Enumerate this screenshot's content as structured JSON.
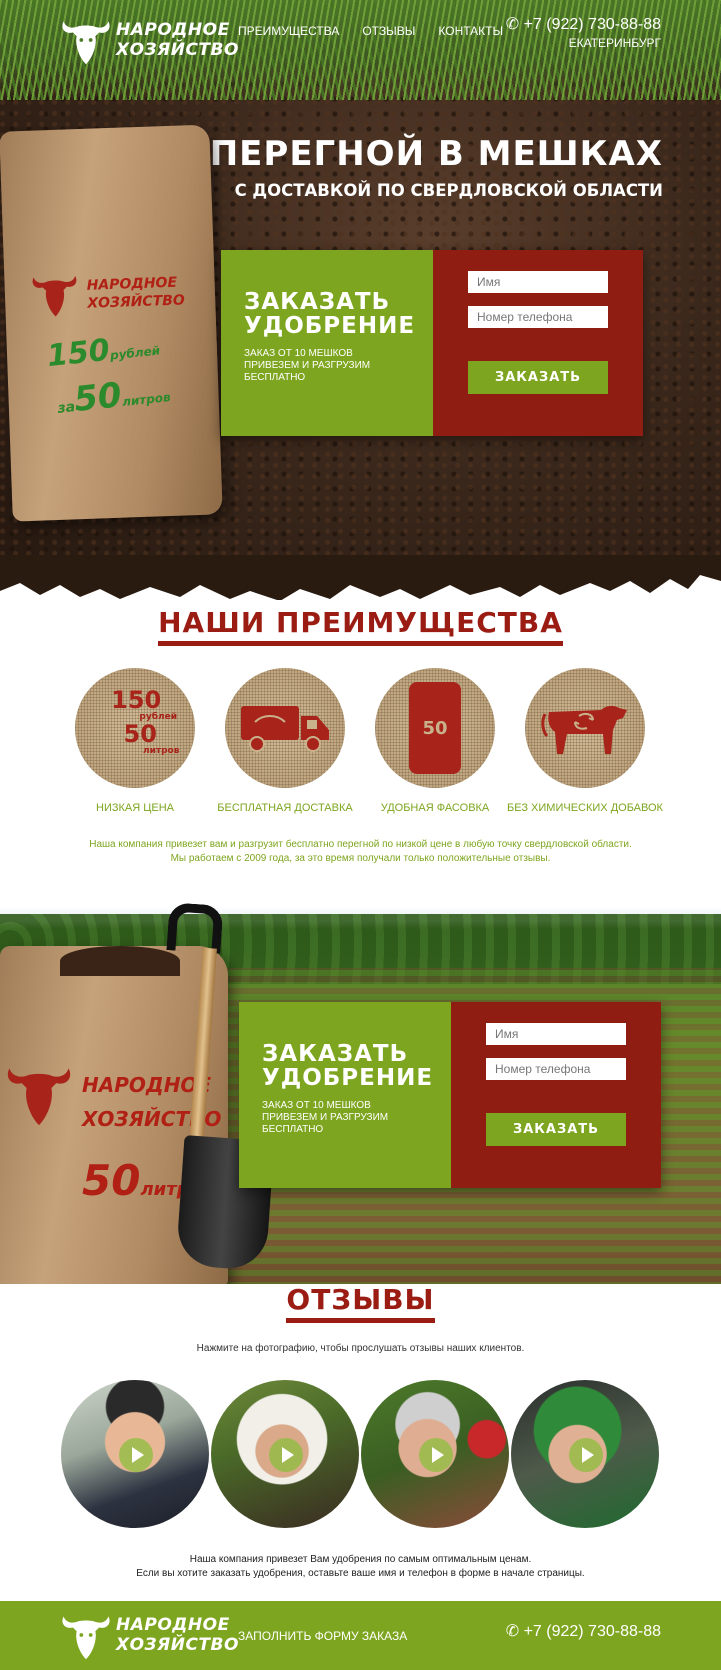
{
  "brand": {
    "line1": "НАРОДНОЕ",
    "line2": "ХОЗЯЙСТВО"
  },
  "nav": [
    {
      "label": "ПРЕИМУЩЕСТВА"
    },
    {
      "label": "ОТЗЫВЫ"
    },
    {
      "label": "КОНТАКТЫ"
    }
  ],
  "contact": {
    "phone": "+7 (922) 730-88-88",
    "city": "ЕКАТЕРИНБУРГ"
  },
  "hero": {
    "title": "ПЕРЕГНОЙ В МЕШКАХ",
    "subtitle": "С ДОСТАВКОЙ ПО СВЕРДЛОВСКОЙ ОБЛАСТИ",
    "sack": {
      "brand1": "НАРОДНОЕ",
      "brand2": "ХОЗЯЙСТВО",
      "price": "150",
      "price_unit": "рублей",
      "prefix": "за",
      "volume": "50",
      "volume_unit": "литров"
    }
  },
  "order_form": {
    "heading_line1": "ЗАКАЗАТЬ",
    "heading_line2": "УДОБРЕНИЕ",
    "note_line1": "ЗАКАЗ ОТ 10 МЕШКОВ",
    "note_line2": "ПРИВЕЗЕМ И РАЗГРУЗИМ",
    "note_line3": "БЕСПЛАТНО",
    "name_placeholder": "Имя",
    "phone_placeholder": "Номер телефона",
    "submit_label": "ЗАКАЗАТЬ"
  },
  "advantages": {
    "title": "НАШИ ПРЕИМУЩЕСТВА",
    "items": [
      {
        "label": "НИЗКАЯ ЦЕНА",
        "icon": "price-icon"
      },
      {
        "label": "БЕСПЛАТНАЯ ДОСТАВКА",
        "icon": "truck-icon"
      },
      {
        "label": "УДОБНАЯ ФАСОВКА",
        "icon": "bag-icon"
      },
      {
        "label": "БЕЗ ХИМИЧЕСКИХ ДОБАВОК",
        "icon": "cow-icon"
      }
    ],
    "price_icon": {
      "price": "150",
      "price_unit": "рублей",
      "volume": "50",
      "volume_unit": "литров"
    },
    "bag_icon_value": "50",
    "text_line1": "Наша компания привезет вам и разгрузит бесплатно перегной по низкой цене в любую точку свердловской области.",
    "text_line2": "Мы работаем с 2009 года, за это время получали только положительные отзывы."
  },
  "banner_sack": {
    "brand1": "НАРОДНОЕ",
    "brand2": "ХОЗЯЙСТВО",
    "volume": "50",
    "volume_unit": "литров"
  },
  "reviews": {
    "title": "ОТЗЫВЫ",
    "hint": "Нажмите на фотографию, чтобы прослушать отзывы наших клиентов.",
    "note_line1": "Наша компания привезет Вам удобрения по самым оптимальным ценам.",
    "note_line2": "Если вы хотите заказать удобрения, оставьте ваше имя и телефон в форме в начале страницы."
  },
  "footer": {
    "link": "ЗАПОЛНИТЬ ФОРМУ ЗАКАЗА",
    "phone": "+7 (922) 730-88-88"
  },
  "colors": {
    "green": "#7ea51f",
    "red": "#8f1d12",
    "title_red": "#9a1c12"
  }
}
